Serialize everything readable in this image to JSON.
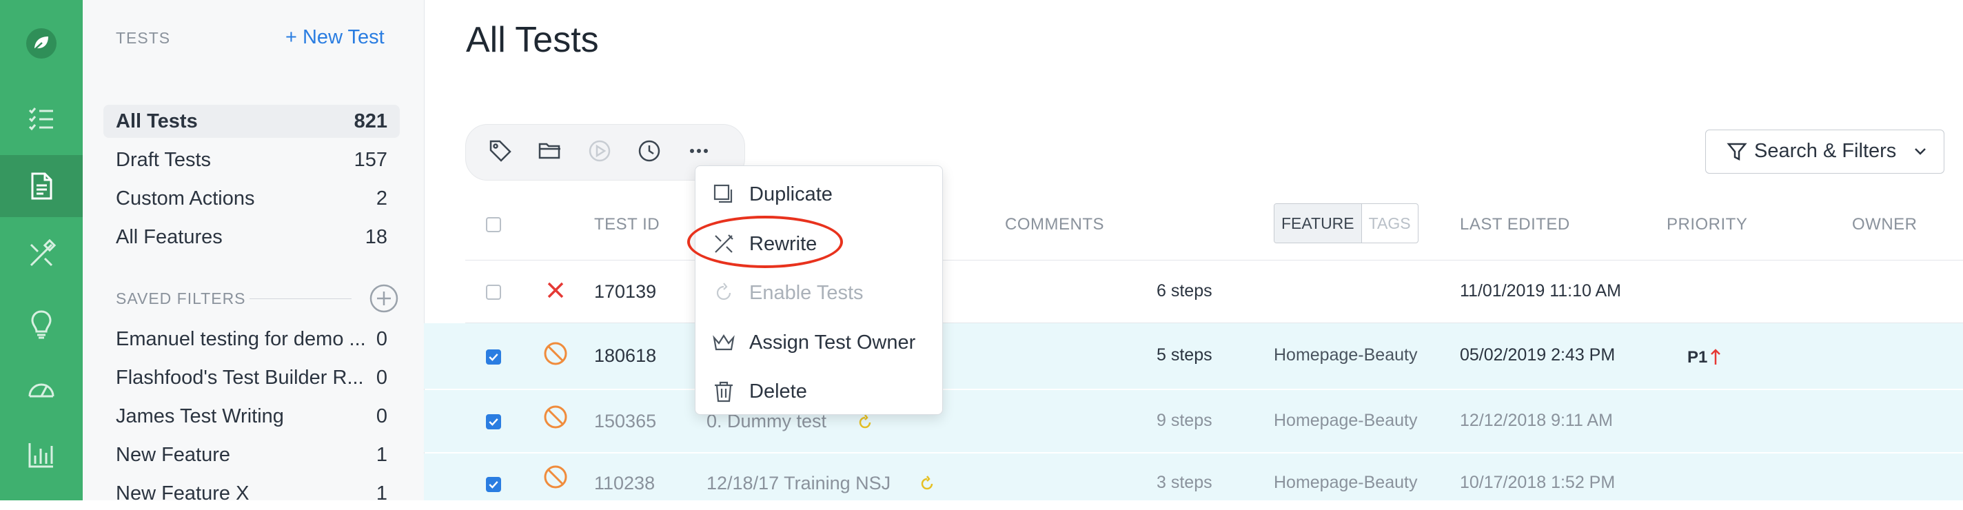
{
  "colors": {
    "brand": "#3fb06f",
    "accent": "#2a7de1",
    "highlight_row": "#e9f8fb",
    "error": "#e53935",
    "warning": "#f08c3c",
    "annotation": "#e8321d"
  },
  "rail": {
    "icons": [
      "leaf-logo-icon",
      "checklist-icon",
      "document-icon",
      "tools-icon",
      "lightbulb-icon",
      "gauge-icon",
      "bar-chart-icon"
    ],
    "active": "document-icon"
  },
  "sidebar": {
    "caption": "TESTS",
    "new_test": "+ New Test",
    "items": [
      {
        "label": "All Tests",
        "count": "821"
      },
      {
        "label": "Draft Tests",
        "count": "157"
      },
      {
        "label": "Custom Actions",
        "count": "2"
      },
      {
        "label": "All Features",
        "count": "18"
      }
    ],
    "saved_caption": "SAVED FILTERS",
    "saved": [
      {
        "label": "Emanuel testing for demo ...",
        "count": "0"
      },
      {
        "label": "Flashfood's Test Builder R...",
        "count": "0"
      },
      {
        "label": "James Test Writing",
        "count": "0"
      },
      {
        "label": "New Feature",
        "count": "1"
      },
      {
        "label": "New Feature X",
        "count": "1"
      }
    ]
  },
  "main": {
    "title": "All Tests",
    "search_filters": "Search & Filters",
    "toolbar_icons": [
      "tag-icon",
      "folder-icon",
      "play-icon",
      "clock-icon",
      "more-icon"
    ],
    "menu": {
      "items": [
        {
          "label": "Duplicate",
          "icon": "duplicate-icon",
          "enabled": true
        },
        {
          "label": "Rewrite",
          "icon": "rewrite-icon",
          "enabled": true
        },
        {
          "label": "Enable Tests",
          "icon": "enable-icon",
          "enabled": false
        },
        {
          "label": "Assign Test Owner",
          "icon": "crown-icon",
          "enabled": true
        },
        {
          "label": "Delete",
          "icon": "trash-icon",
          "enabled": true
        }
      ]
    },
    "columns": {
      "test_id": "TEST ID",
      "comments": "COMMENTS",
      "feature": "FEATURE",
      "tags": "TAGS",
      "last_edited": "LAST EDITED",
      "priority": "PRIORITY",
      "owner": "OWNER"
    },
    "rows": [
      {
        "checked": false,
        "status": "error",
        "id": "170139",
        "name": "",
        "steps": "6 steps",
        "feature": "",
        "edited": "11/01/2019 11:10 AM",
        "priority": ""
      },
      {
        "checked": true,
        "status": "disabled",
        "id": "180618",
        "name": "",
        "steps": "5 steps",
        "feature": "Homepage-Beauty",
        "edited": "05/02/2019 2:43 PM",
        "priority": "P1"
      },
      {
        "checked": true,
        "status": "disabled",
        "id": "150365",
        "name": "0. Dummy test",
        "steps": "9 steps",
        "feature": "Homepage-Beauty",
        "edited": "12/12/2018 9:11 AM",
        "priority": ""
      },
      {
        "checked": true,
        "status": "disabled",
        "id": "110238",
        "name": "12/18/17 Training NSJ",
        "steps": "3 steps",
        "feature": "Homepage-Beauty",
        "edited": "10/17/2018 1:52 PM",
        "priority": ""
      }
    ]
  }
}
